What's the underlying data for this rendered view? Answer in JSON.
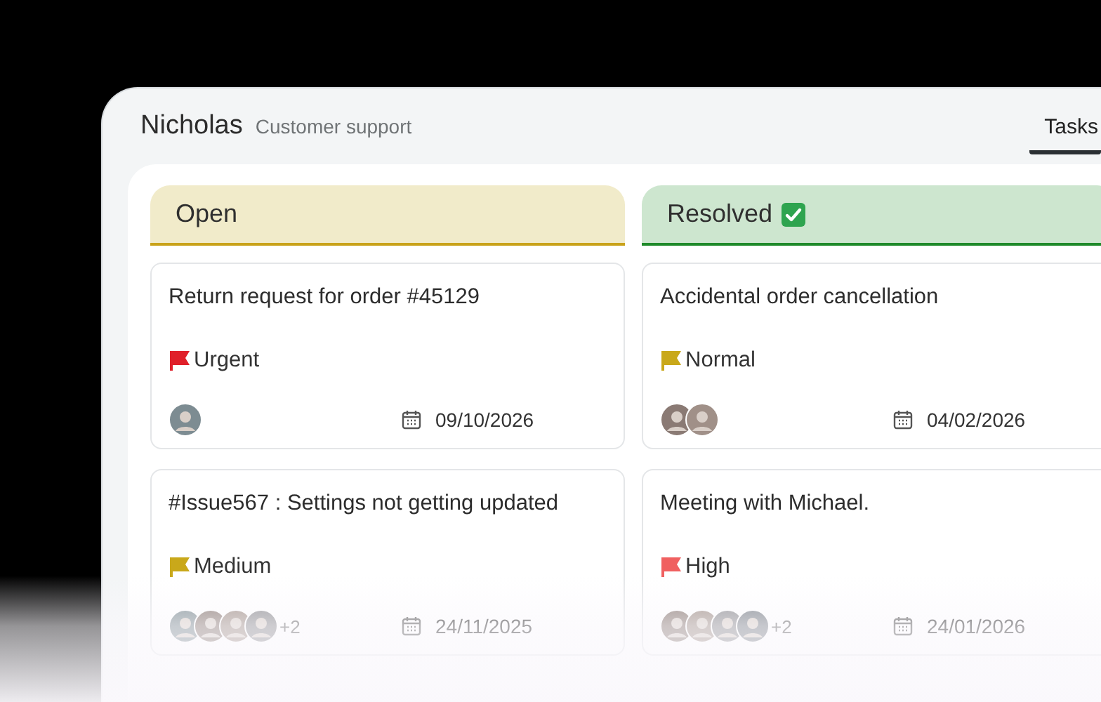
{
  "header": {
    "name": "Nicholas",
    "role": "Customer support"
  },
  "tabs": [
    {
      "label": "Tasks",
      "selected": true
    }
  ],
  "columns": [
    {
      "title": "Open",
      "kind": "open",
      "color": "#c9a21a",
      "cards": [
        {
          "title": "Return request for order #45129",
          "priority": {
            "label": "Urgent",
            "color": "#e0202a"
          },
          "assignees": [
            {
              "kind": "avatar"
            }
          ],
          "date": "09/10/2026"
        },
        {
          "title": "#Issue567 : Settings not getting updated",
          "priority": {
            "label": "Medium",
            "color": "#c9a81a"
          },
          "assignees": [
            {
              "kind": "avatar"
            },
            {
              "kind": "avatar"
            },
            {
              "kind": "avatar"
            },
            {
              "kind": "avatar"
            }
          ],
          "extra": "+2",
          "date": "24/11/2025"
        }
      ]
    },
    {
      "title": "Resolved",
      "kind": "resolved",
      "color": "#1f8a2a",
      "cards": [
        {
          "title": "Accidental order cancellation",
          "priority": {
            "label": "Normal",
            "color": "#c9a81a"
          },
          "assignees": [
            {
              "kind": "avatar"
            },
            {
              "kind": "avatar"
            }
          ],
          "date": "04/02/2026"
        },
        {
          "title": "Meeting with Michael.",
          "priority": {
            "label": "High",
            "color": "#f06060"
          },
          "assignees": [
            {
              "kind": "avatar"
            },
            {
              "kind": "avatar"
            },
            {
              "kind": "avatar"
            },
            {
              "kind": "avatar"
            }
          ],
          "extra": "+2",
          "date": "24/01/2026"
        }
      ]
    }
  ]
}
